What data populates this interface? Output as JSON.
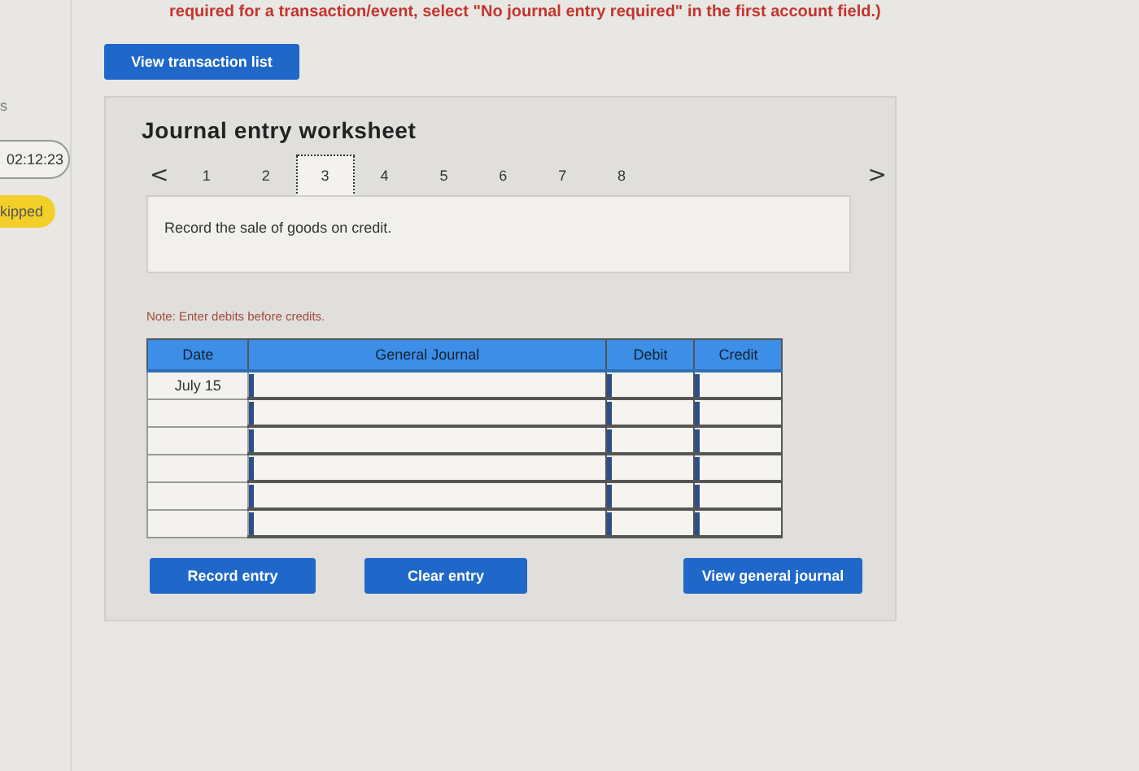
{
  "instruction": "required for a transaction/event, select \"No journal entry required\" in the first account field.)",
  "sidebar": {
    "label": "s",
    "timer": "02:12:23",
    "status": "kipped"
  },
  "view_transaction_button": "View transaction list",
  "worksheet": {
    "title": "Journal entry worksheet",
    "prev": "<",
    "next": ">",
    "pages": [
      {
        "label": "1",
        "selected": false
      },
      {
        "label": "2",
        "selected": false
      },
      {
        "label": "3",
        "selected": true
      },
      {
        "label": "4",
        "selected": false
      },
      {
        "label": "5",
        "selected": false
      },
      {
        "label": "6",
        "selected": false
      },
      {
        "label": "7",
        "selected": false
      },
      {
        "label": "8",
        "selected": false
      }
    ],
    "description": "Record the sale of goods on credit.",
    "note": "Note: Enter debits before credits.",
    "table": {
      "columns": [
        "Date",
        "General Journal",
        "Debit",
        "Credit"
      ],
      "rows": [
        {
          "date": "July 15"
        },
        {},
        {},
        {},
        {},
        {}
      ]
    },
    "buttons": [
      "Record entry",
      "Clear entry",
      "View general journal"
    ]
  }
}
